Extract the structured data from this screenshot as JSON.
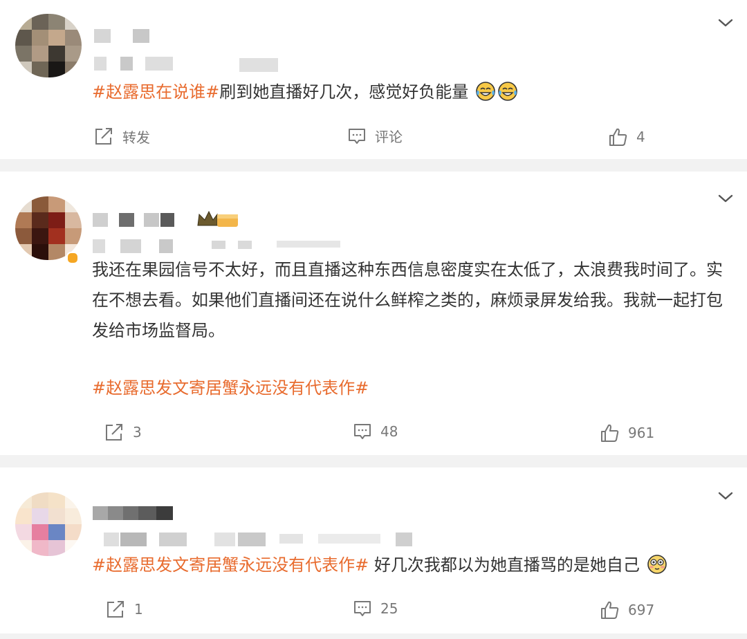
{
  "posts": [
    {
      "text": "刷到她直播好几次，感觉好负能量",
      "tag": "#赵露思在说谁#",
      "emojis": [
        "crying-laughing-emoji",
        "crying-laughing-emoji"
      ],
      "actions": {
        "repost": "转发",
        "comment": "评论",
        "like": "4"
      }
    },
    {
      "text": "我还在果园信号不太好，而且直播这种东西信息密度实在太低了，太浪费我时间了。实在不想去看。如果他们直播间还在说什么鲜榨之类的，麻烦录屏发给我。我就一起打包发给市场监督局。",
      "tag": "#赵露思发文寄居蟹永远没有代表作#",
      "actions": {
        "repost": "3",
        "comment": "48",
        "like": "961"
      }
    },
    {
      "tag": "#赵露思发文寄居蟹永远没有代表作#",
      "text": " 好几次我都以为她直播骂的是她自己",
      "emojis": [
        "flushed-face-emoji"
      ],
      "actions": {
        "repost": "1",
        "comment": "25",
        "like": "697"
      }
    }
  ],
  "colors": {
    "tag": "#e86b2e",
    "divider": "#f2f2f2",
    "text": "#333333",
    "meta": "#777777"
  }
}
